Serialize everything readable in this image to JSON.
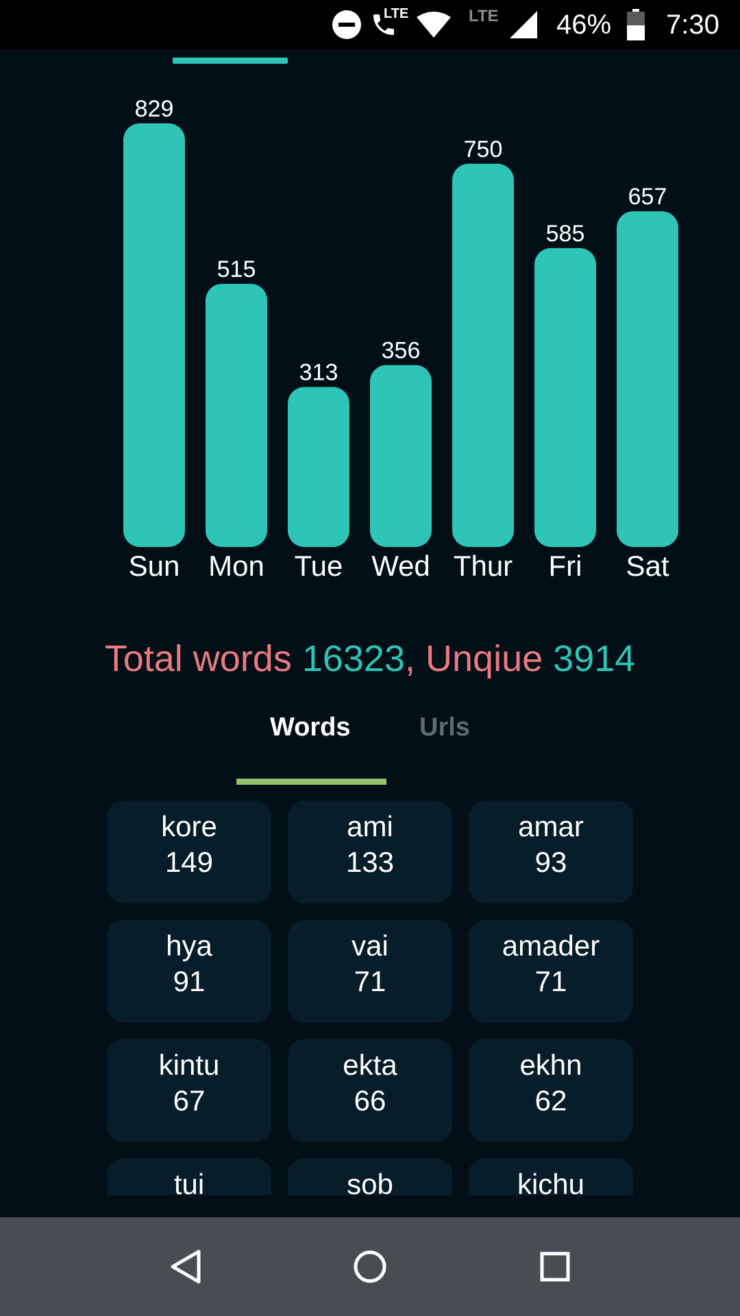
{
  "status_bar": {
    "icons": [
      "do-not-disturb-icon",
      "volte-call-icon",
      "wifi-icon",
      "signal-icon",
      "battery-icon"
    ],
    "lte_call_label": "LTE",
    "lte_label": "LTE",
    "battery": "46%",
    "time": "7:30"
  },
  "chart_data": {
    "type": "bar",
    "categories": [
      "Sun",
      "Mon",
      "Tue",
      "Wed",
      "Thur",
      "Fri",
      "Sat"
    ],
    "values": [
      829,
      515,
      313,
      356,
      750,
      585,
      657
    ],
    "title": "",
    "xlabel": "",
    "ylabel": "",
    "ylim": [
      0,
      829
    ],
    "grid": false,
    "bar_color": "#2ec4b6"
  },
  "summary": {
    "total_label": "Total words ",
    "total_value": "16323",
    "sep": ", ",
    "unique_label": "Unqiue ",
    "unique_value": "3914"
  },
  "tabs": [
    {
      "label": "Words",
      "active": true
    },
    {
      "label": "Urls",
      "active": false
    }
  ],
  "words": [
    {
      "word": "kore",
      "count": "149"
    },
    {
      "word": "ami",
      "count": "133"
    },
    {
      "word": "amar",
      "count": "93"
    },
    {
      "word": "hya",
      "count": "91"
    },
    {
      "word": "vai",
      "count": "71"
    },
    {
      "word": "amader",
      "count": "71"
    },
    {
      "word": "kintu",
      "count": "67"
    },
    {
      "word": "ekta",
      "count": "66"
    },
    {
      "word": "ekhn",
      "count": "62"
    },
    {
      "word": "tui",
      "count": ""
    },
    {
      "word": "sob",
      "count": ""
    },
    {
      "word": "kichu",
      "count": ""
    }
  ],
  "nav": [
    "back-icon",
    "home-icon",
    "recents-icon"
  ],
  "colors": {
    "background": "#030f17",
    "accent": "#2ec4b6",
    "label": "#ea7a80",
    "tab_indicator": "#8fc269",
    "card": "#071d29"
  }
}
